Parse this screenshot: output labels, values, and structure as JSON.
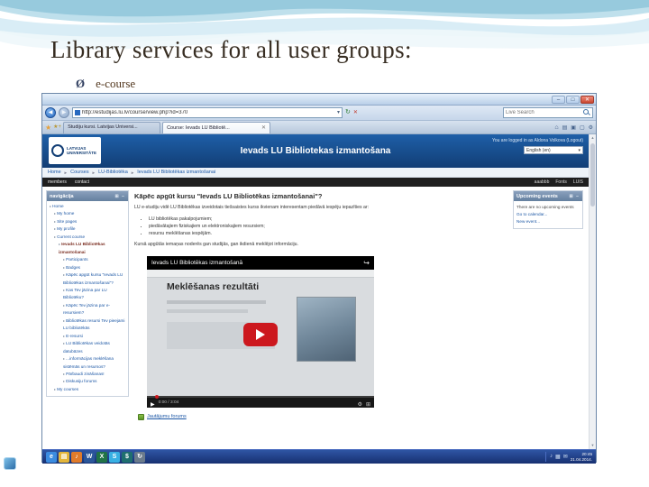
{
  "slide": {
    "title": "Library services for all user groups:",
    "bullet_symbol": "Ø",
    "bullet_text": "e-course"
  },
  "browser": {
    "controls": {
      "minimize": "–",
      "maximize": "□",
      "close": "✕"
    },
    "address_url": "http://estudijas.lu.lv/course/view.php?id=370",
    "search_placeholder": "Live Search",
    "tab_close": "✕",
    "tabs": [
      {
        "label": "Studiju kursi. Latvijas Universi..."
      },
      {
        "label": "Course: Ievads LU Bibliotē..."
      }
    ]
  },
  "page": {
    "logo": {
      "line1": "LATVIJAS",
      "line2": "UNIVERSITĀTE"
    },
    "header_title": "Ievads LU Bibliotekas izmantošana",
    "login_text": "You are logged in as Aldona Volkova (Logout)",
    "language_value": "English (en)",
    "breadcrumb": [
      "Home",
      "Courses",
      "LU-Bibliotēka",
      "Ievads LU Bibliotēkas izmantošanai"
    ],
    "utility_left": [
      "members",
      "contact"
    ],
    "utility_right": [
      "aaabbb",
      "Fonts",
      "LUIS"
    ],
    "navigation": {
      "title": "navigācija",
      "items": [
        {
          "label": "Home",
          "level": 0,
          "style": "link"
        },
        {
          "label": "My home",
          "level": 1,
          "style": "link"
        },
        {
          "label": "Site pages",
          "level": 1,
          "style": "link"
        },
        {
          "label": "My profile",
          "level": 1,
          "style": "link"
        },
        {
          "label": "Current course",
          "level": 1,
          "style": "link"
        },
        {
          "label": "Ievads LU Bibliotēkas izmantošanai",
          "level": 2,
          "style": "current"
        },
        {
          "label": "Participants",
          "level": 3,
          "style": "link"
        },
        {
          "label": "Badges",
          "level": 3,
          "style": "link"
        },
        {
          "label": "Kāpēc apgūt kursu \"Ievads LU Bibliotēkas izmantošanai\"?",
          "level": 3,
          "style": "link"
        },
        {
          "label": "Kas Tev jāzina par LU Bibliotēku?",
          "level": 3,
          "style": "link"
        },
        {
          "label": "Kāpēc Tev jāzina par e-resursiem?",
          "level": 3,
          "style": "link"
        },
        {
          "label": "Bibliotēkas resursi Tev pieejami LU bibliotēkās",
          "level": 3,
          "style": "link"
        },
        {
          "label": "E-resursi",
          "level": 3,
          "style": "link"
        },
        {
          "label": "LU Bibliotēkas veidotās datubāzes",
          "level": 3,
          "style": "link"
        },
        {
          "label": "...informācijas meklēšana sistēmās un resursos?",
          "level": 3,
          "style": "link"
        },
        {
          "label": "Pārbaudi zināšanas!",
          "level": 3,
          "style": "link"
        },
        {
          "label": "Diskusiju forums",
          "level": 3,
          "style": "link"
        },
        {
          "label": "My courses",
          "level": 1,
          "style": "link"
        }
      ]
    },
    "content": {
      "heading": "Kāpēc apgūt kursu \"Ievads LU Bibliotēkas izmantošanai\"?",
      "intro": "LU e-studiju vidē LU Bibliotēkas izveidotais tiešsaistes kurss ikvienam interesentam piedāvā iespēju iepazīties ar:",
      "bullets": [
        "LU bibliotēkas pakalpojumiem;",
        "piedāvātajiem fiziskajiem un elektroniskajiem resursiem;",
        "resursu meklēšanas iespējām."
      ],
      "outro": "Kursā apgūtās iemaņas noderēs gan studijās, gan ikdienā meklējot informāciju.",
      "video": {
        "title": "Ievads LU Bibliotēkas izmantošanā",
        "overlay_heading": "Meklēšanas rezultāti",
        "time": "0:00 / 3:04"
      },
      "forum_link": "Jautājumu forums"
    },
    "events": {
      "title": "Upcoming events",
      "empty_text": "There are no upcoming events",
      "links": [
        "Go to calendar...",
        "New event..."
      ]
    }
  },
  "taskbar": {
    "icons": [
      {
        "name": "internet-explorer-icon",
        "glyph": "e",
        "bg": "#3b8ce0"
      },
      {
        "name": "folder-icon",
        "glyph": "▤",
        "bg": "#e3b53a"
      },
      {
        "name": "media-player-icon",
        "glyph": "♪",
        "bg": "#e07b2a"
      },
      {
        "name": "word-icon",
        "glyph": "W",
        "bg": "#2b579a"
      },
      {
        "name": "excel-icon",
        "glyph": "X",
        "bg": "#217346"
      },
      {
        "name": "skype-icon",
        "glyph": "S",
        "bg": "#38b0e3"
      },
      {
        "name": "bank-icon",
        "glyph": "$",
        "bg": "#1f6f6f"
      },
      {
        "name": "update-icon",
        "glyph": "↻",
        "bg": "#6b7b8c"
      }
    ],
    "tray": [
      "♪",
      "▦",
      "✉"
    ],
    "clock_time": "20:45",
    "clock_date": "21.04.2014."
  },
  "colors": {
    "header_blue": "#1b5292",
    "block_header_blue": "#64809f",
    "link_blue": "#1c57a5",
    "play_red": "#cc181e",
    "taskbar_blue": "#24439a"
  }
}
